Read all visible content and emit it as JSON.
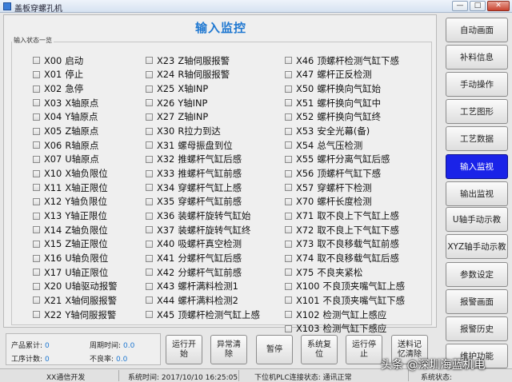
{
  "window": {
    "title": "盖板穿螺孔机",
    "controls": [
      "—",
      "□",
      "✕"
    ]
  },
  "page": {
    "title": "输入监控",
    "group_label": "输入状态一览"
  },
  "inputs": {
    "col1": [
      {
        "code": "X00",
        "label": "启动"
      },
      {
        "code": "X01",
        "label": "停止"
      },
      {
        "code": "X02",
        "label": "急停"
      },
      {
        "code": "X03",
        "label": "X轴原点"
      },
      {
        "code": "X04",
        "label": "Y轴原点"
      },
      {
        "code": "X05",
        "label": "Z轴原点"
      },
      {
        "code": "X06",
        "label": "R轴原点"
      },
      {
        "code": "X07",
        "label": "U轴原点"
      },
      {
        "code": "X10",
        "label": "X轴负限位"
      },
      {
        "code": "X11",
        "label": "X轴正限位"
      },
      {
        "code": "X12",
        "label": "Y轴负限位"
      },
      {
        "code": "X13",
        "label": "Y轴正限位"
      },
      {
        "code": "X14",
        "label": "Z轴负限位"
      },
      {
        "code": "X15",
        "label": "Z轴正限位"
      },
      {
        "code": "X16",
        "label": "U轴负限位"
      },
      {
        "code": "X17",
        "label": "U轴正限位"
      },
      {
        "code": "X20",
        "label": "U轴驱动报警"
      },
      {
        "code": "X21",
        "label": "X轴伺服报警"
      },
      {
        "code": "X22",
        "label": "Y轴伺服报警"
      }
    ],
    "col2": [
      {
        "code": "X23",
        "label": "Z轴伺服报警"
      },
      {
        "code": "X24",
        "label": "R轴伺服报警"
      },
      {
        "code": "X25",
        "label": "X轴INP"
      },
      {
        "code": "X26",
        "label": "Y轴INP"
      },
      {
        "code": "X27",
        "label": "Z轴INP"
      },
      {
        "code": "X30",
        "label": "R拉力到达"
      },
      {
        "code": "X31",
        "label": "螺母振盘到位"
      },
      {
        "code": "X32",
        "label": "推螺杆气缸后感"
      },
      {
        "code": "X33",
        "label": "推螺杆气缸前感"
      },
      {
        "code": "X34",
        "label": "穿螺杆气缸上感"
      },
      {
        "code": "X35",
        "label": "穿螺杆气缸前感"
      },
      {
        "code": "X36",
        "label": "装螺杆旋转气缸始"
      },
      {
        "code": "X37",
        "label": "装螺杆旋转气缸终"
      },
      {
        "code": "X40",
        "label": "吸螺杆真空检测"
      },
      {
        "code": "X41",
        "label": "分螺杆气缸后感"
      },
      {
        "code": "X42",
        "label": "分螺杆气缸前感"
      },
      {
        "code": "X43",
        "label": "螺杆满料检测1"
      },
      {
        "code": "X44",
        "label": "螺杆满料检测2"
      },
      {
        "code": "X45",
        "label": "顶螺杆检测气缸上感"
      }
    ],
    "col3": [
      {
        "code": "X46",
        "label": "顶螺杆检测气缸下感"
      },
      {
        "code": "X47",
        "label": "螺杆正反检测"
      },
      {
        "code": "X50",
        "label": "螺杆换向气缸始"
      },
      {
        "code": "X51",
        "label": "螺杆换向气缸中"
      },
      {
        "code": "X52",
        "label": "螺杆换向气缸终"
      },
      {
        "code": "X53",
        "label": "安全光幕(备)"
      },
      {
        "code": "X54",
        "label": "总气压检测"
      },
      {
        "code": "X55",
        "label": "螺杆分离气缸后感"
      },
      {
        "code": "X56",
        "label": "顶螺杆气缸下感"
      },
      {
        "code": "X57",
        "label": "穿螺杆下检测"
      },
      {
        "code": "X70",
        "label": "螺杆长度检测"
      },
      {
        "code": "X71",
        "label": "取不良上下气缸上感"
      },
      {
        "code": "X72",
        "label": "取不良上下气缸下感"
      },
      {
        "code": "X73",
        "label": "取不良移载气缸前感"
      },
      {
        "code": "X74",
        "label": "取不良移载气缸后感"
      },
      {
        "code": "X75",
        "label": "不良夹紧松"
      },
      {
        "code": "X100",
        "label": "不良顶夹嘴气缸上感"
      },
      {
        "code": "X101",
        "label": "不良顶夹嘴气缸下感"
      },
      {
        "code": "X102",
        "label": "检测气缸上感应"
      },
      {
        "code": "X103",
        "label": "检测气缸下感应"
      }
    ]
  },
  "nav": [
    {
      "label": "自动画面",
      "active": false
    },
    {
      "label": "补料信息",
      "active": false
    },
    {
      "label": "手动操作",
      "active": false
    },
    {
      "label": "工艺图形",
      "active": false
    },
    {
      "label": "工艺数据",
      "active": false
    },
    {
      "label": "输入监视",
      "active": true
    },
    {
      "label": "输出监视",
      "active": false
    },
    {
      "label": "U轴手动示教",
      "active": false
    },
    {
      "label": "XYZ轴手动示教",
      "active": false
    },
    {
      "label": "参数设定",
      "active": false
    },
    {
      "label": "报警画面",
      "active": false
    },
    {
      "label": "报警历史",
      "active": false
    },
    {
      "label": "维护功能",
      "active": false
    }
  ],
  "stats": {
    "product_count_label": "产品累计:",
    "product_count": "0",
    "cycle_time_label": "周期时间:",
    "cycle_time": "0.0",
    "process_count_label": "工序计数:",
    "process_count": "0",
    "defect_rate_label": "不良率:",
    "defect_rate": "0.0"
  },
  "actions": [
    {
      "label": "运行开始"
    },
    {
      "label": "异常清除"
    },
    {
      "label": "暂停"
    },
    {
      "label": "系统复位"
    },
    {
      "label": "运行停止"
    },
    {
      "label": "送料记忆清除"
    }
  ],
  "statusbar": {
    "comm": "XX通信开发",
    "time": "系统时间: 2017/10/10 16:25:05",
    "plc": "下位机PLC连接状态: 通讯正常",
    "system_status": "系统状态:"
  },
  "watermark": "头条 @深圳海蓝机电",
  "colors": {
    "accent": "#1f78d1",
    "active_nav": "#1a23e8"
  }
}
